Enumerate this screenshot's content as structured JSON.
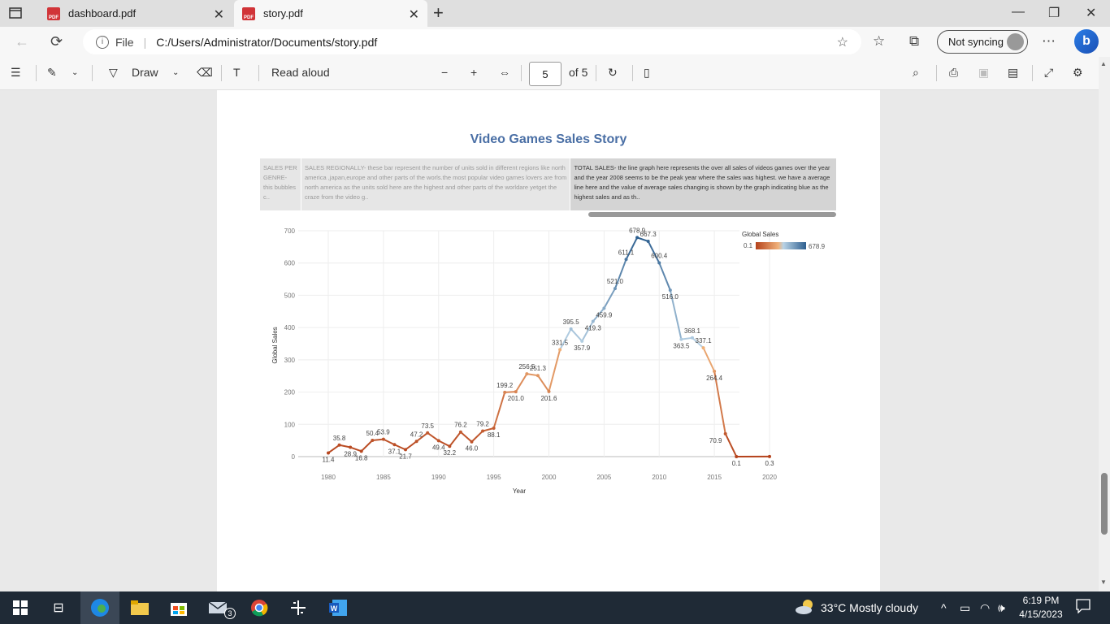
{
  "browser": {
    "tabs": [
      {
        "title": "dashboard.pdf",
        "active": false
      },
      {
        "title": "story.pdf",
        "active": true
      }
    ],
    "omnibox": {
      "scheme_label": "File",
      "url": "C:/Users/Administrator/Documents/story.pdf"
    },
    "sync_label": "Not syncing"
  },
  "pdf_toolbar": {
    "draw_label": "Draw",
    "read_aloud_label": "Read aloud",
    "page_value": "5",
    "page_total": "of 5"
  },
  "story": {
    "title": "Video Games Sales Story",
    "points": [
      {
        "text": "SALES PER GENRE- this bubbles c..",
        "selected": false
      },
      {
        "text": "SALES REGIONALLY- these bar represent the number of units sold in different regions like north america ,japan,europe and other parts of the worls.the most popular video games lovers are from north america as the units sold here are the highest and other parts of the worldare yetget the craze from the video g..",
        "selected": false
      },
      {
        "text": "TOTAL SALES- the line graph here represents the over all sales of videos games over the year and the year 2008 seems to be the peak year where the sales was highest. we have a average line here and the value of average sales changing is shown by the graph indicating blue as the highest sales and as th..",
        "selected": true
      }
    ]
  },
  "chart_data": {
    "type": "line",
    "xlabel": "Year",
    "ylabel": "Global Sales",
    "ylim": [
      0,
      700
    ],
    "xlim": [
      1980,
      2020
    ],
    "x_ticks": [
      "1980",
      "1985",
      "1990",
      "1995",
      "2000",
      "2005",
      "2010",
      "2015",
      "2020"
    ],
    "y_ticks": [
      "0",
      "100",
      "200",
      "300",
      "400",
      "500",
      "600",
      "700"
    ],
    "grid": true,
    "legend": {
      "title": "Global Sales",
      "min_label": "0.1",
      "max_label": "678.9",
      "placement": "top-right"
    },
    "colors": {
      "low": "#b5421b",
      "mid": "#f0b27a",
      "high": "#2d5f8f"
    },
    "series": [
      {
        "x": [
          1980,
          1981,
          1982,
          1983,
          1984,
          1985,
          1986,
          1987,
          1988,
          1989,
          1990,
          1991,
          1992,
          1993,
          1994,
          1995,
          1996,
          1997,
          1998,
          1999,
          2000,
          2001,
          2002,
          2003,
          2004,
          2005,
          2006,
          2007,
          2008,
          2009,
          2010,
          2011,
          2012,
          2013,
          2014,
          2015,
          2016,
          2017,
          2020
        ],
        "y": [
          11.4,
          35.8,
          28.9,
          16.8,
          50.4,
          53.9,
          37.1,
          21.7,
          47.2,
          73.5,
          49.4,
          32.2,
          76.2,
          46.0,
          79.2,
          88.1,
          199.2,
          201.0,
          256.5,
          251.3,
          201.6,
          331.5,
          395.5,
          357.9,
          419.3,
          459.9,
          521.0,
          611.1,
          678.9,
          667.3,
          600.4,
          516.0,
          363.5,
          368.1,
          337.1,
          264.4,
          70.9,
          0.1,
          0.3
        ],
        "labels": [
          "11.4",
          "35.8",
          "28.9",
          "16.8",
          "50.4",
          "53.9",
          "37.1",
          "21.7",
          "47.2",
          "73.5",
          "49.4",
          "32.2",
          "76.2",
          "46.0",
          "79.2",
          "88.1",
          "199.2",
          "201.0",
          "256.5",
          "251.3",
          "201.6",
          "331.5",
          "395.5",
          "357.9",
          "419.3",
          "459.9",
          "521.0",
          "611.1",
          "678.9",
          "667.3",
          "600.4",
          "516.0",
          "363.5",
          "368.1",
          "337.1",
          "264.4",
          "70.9",
          "0.1",
          "0.3"
        ]
      }
    ]
  },
  "taskbar": {
    "mail_badge": "3",
    "weather": "33°C  Mostly cloudy",
    "time": "6:19 PM",
    "date": "4/15/2023"
  }
}
